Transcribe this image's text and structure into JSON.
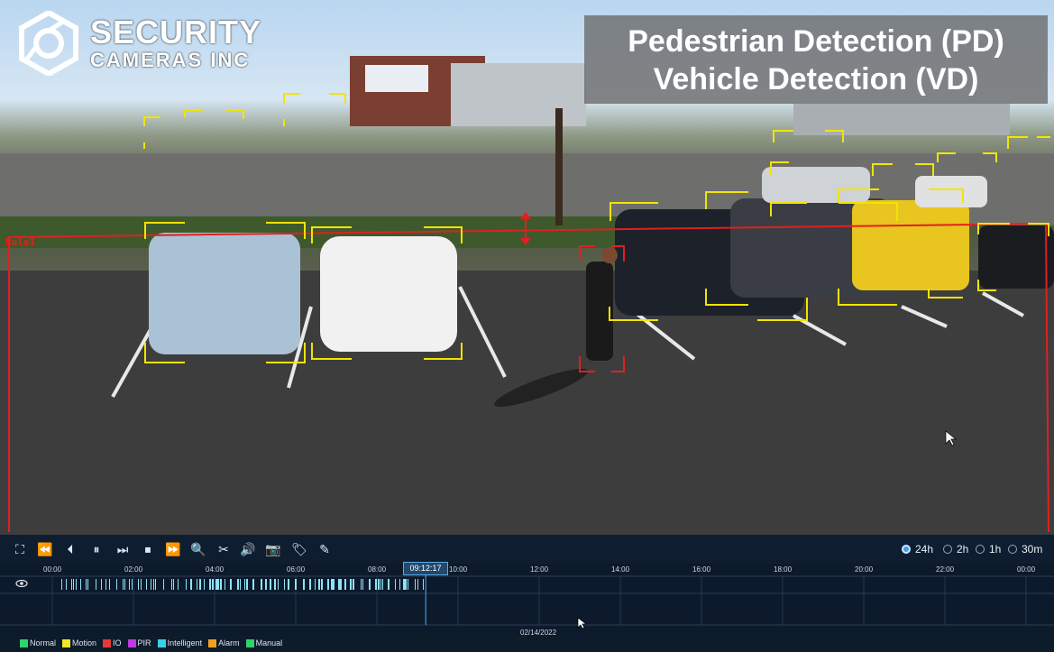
{
  "logo": {
    "line1": "SECURITY",
    "line2": "CAMERAS INC"
  },
  "banner": {
    "line1": "Pedestrian Detection (PD)",
    "line2": "Vehicle Detection (VD)"
  },
  "overlay": {
    "rule_label": "Rule1",
    "rule_color": "#e02020",
    "vehicle_box_color": "#f2e400",
    "person_box_color": "#e02020"
  },
  "toolbar": {
    "buttons": [
      {
        "name": "fullscreen-icon",
        "glyph": "⛶"
      },
      {
        "name": "rewind-icon",
        "glyph": "⏪"
      },
      {
        "name": "reverse-play-icon",
        "glyph": "⏴"
      },
      {
        "name": "pause-icon",
        "glyph": "⏸"
      },
      {
        "name": "step-forward-icon",
        "glyph": "⏭"
      },
      {
        "name": "stop-icon",
        "glyph": "⏹"
      },
      {
        "name": "fast-forward-icon",
        "glyph": "⏩"
      },
      {
        "name": "zoom-icon",
        "glyph": "🔍"
      },
      {
        "name": "clip-icon",
        "glyph": "✂"
      },
      {
        "name": "audio-icon",
        "glyph": "🔊"
      },
      {
        "name": "snapshot-icon",
        "glyph": "📷"
      },
      {
        "name": "tag-icon",
        "glyph": "🏷"
      },
      {
        "name": "edit-tag-icon",
        "glyph": "✎"
      }
    ],
    "ranges": [
      {
        "label": "24h",
        "selected": true
      },
      {
        "label": "2h",
        "selected": false
      },
      {
        "label": "1h",
        "selected": false
      },
      {
        "label": "30m",
        "selected": false
      }
    ]
  },
  "timeline": {
    "ticks": [
      "00:00",
      "02:00",
      "04:00",
      "06:00",
      "08:00",
      "10:00",
      "12:00",
      "14:00",
      "16:00",
      "18:00",
      "20:00",
      "22:00",
      "00:00"
    ],
    "current_time": "09:12:17",
    "current_time_fraction": 0.3835,
    "date": "02/14/2022",
    "recording_color": "#8fe2f5"
  },
  "legend": [
    {
      "label": "Normal",
      "color": "#2fd36a"
    },
    {
      "label": "Motion",
      "color": "#f3e42a"
    },
    {
      "label": "IO",
      "color": "#e43a3a"
    },
    {
      "label": "PIR",
      "color": "#c03ae4"
    },
    {
      "label": "Intelligent",
      "color": "#3ad0e4"
    },
    {
      "label": "Alarm",
      "color": "#f0a020"
    },
    {
      "label": "Manual",
      "color": "#2fd36a"
    }
  ]
}
